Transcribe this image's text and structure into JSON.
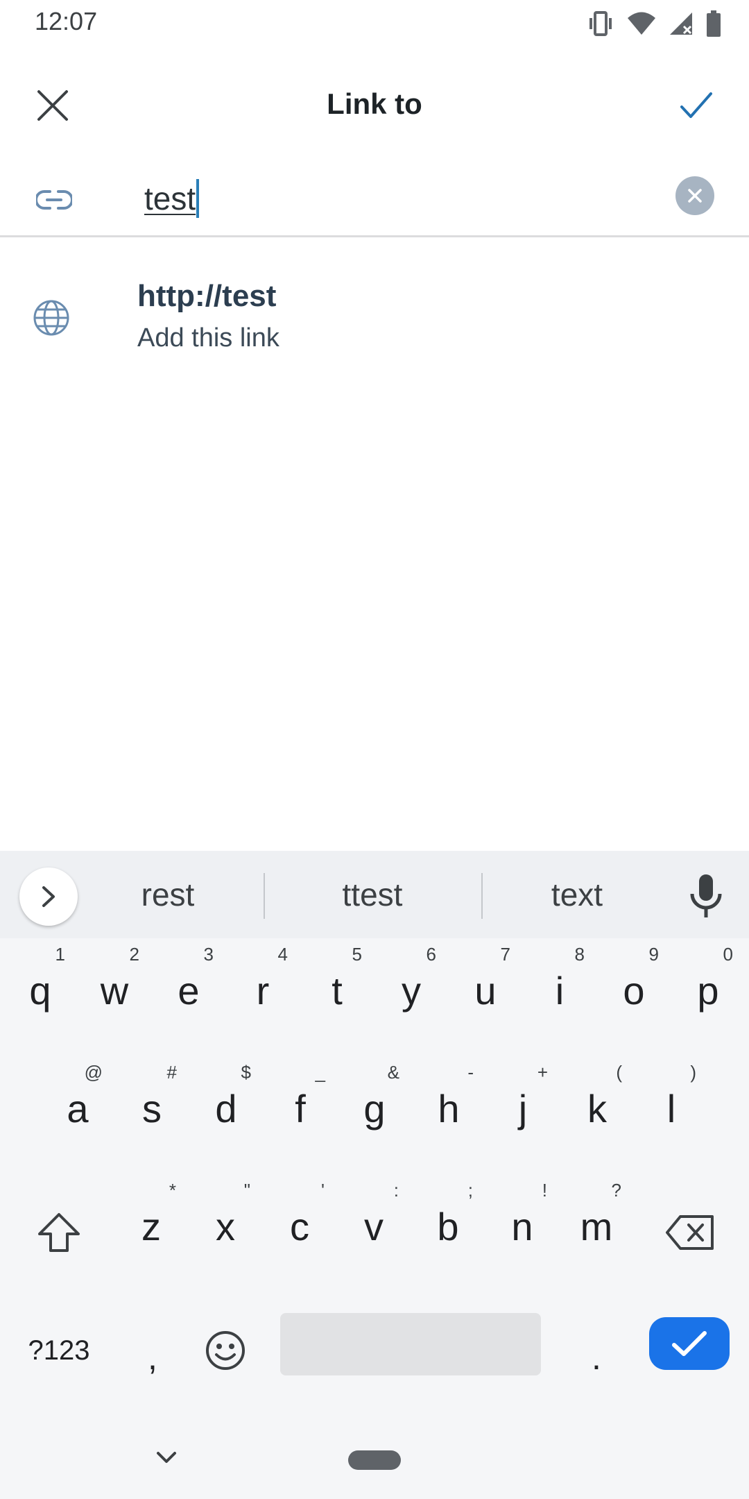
{
  "status_bar": {
    "time": "12:07",
    "icons": [
      "vibrate-icon",
      "wifi-icon",
      "signal-icon",
      "battery-icon"
    ]
  },
  "app_bar": {
    "title": "Link to",
    "close_icon": "close-icon",
    "confirm_icon": "check-icon",
    "accent_color": "#2271b1"
  },
  "url_field": {
    "value": "test",
    "link_icon": "link-icon",
    "clear_icon": "clear-icon"
  },
  "suggestion": {
    "url": "http://test",
    "action": "Add this link",
    "icon": "globe-icon"
  },
  "keyboard": {
    "suggestions": [
      "rest",
      "ttest",
      "text"
    ],
    "row1": [
      {
        "ch": "q",
        "hint": "1"
      },
      {
        "ch": "w",
        "hint": "2"
      },
      {
        "ch": "e",
        "hint": "3"
      },
      {
        "ch": "r",
        "hint": "4"
      },
      {
        "ch": "t",
        "hint": "5"
      },
      {
        "ch": "y",
        "hint": "6"
      },
      {
        "ch": "u",
        "hint": "7"
      },
      {
        "ch": "i",
        "hint": "8"
      },
      {
        "ch": "o",
        "hint": "9"
      },
      {
        "ch": "p",
        "hint": "0"
      }
    ],
    "row2": [
      {
        "ch": "a",
        "hint": "@"
      },
      {
        "ch": "s",
        "hint": "#"
      },
      {
        "ch": "d",
        "hint": "$"
      },
      {
        "ch": "f",
        "hint": "_"
      },
      {
        "ch": "g",
        "hint": "&"
      },
      {
        "ch": "h",
        "hint": "-"
      },
      {
        "ch": "j",
        "hint": "+"
      },
      {
        "ch": "k",
        "hint": "("
      },
      {
        "ch": "l",
        "hint": ")"
      }
    ],
    "row3": [
      {
        "ch": "z",
        "hint": "*"
      },
      {
        "ch": "x",
        "hint": "\""
      },
      {
        "ch": "c",
        "hint": "'"
      },
      {
        "ch": "v",
        "hint": ":"
      },
      {
        "ch": "b",
        "hint": ";"
      },
      {
        "ch": "n",
        "hint": "!"
      },
      {
        "ch": "m",
        "hint": "?"
      }
    ],
    "symbols_label": "?123",
    "comma": ",",
    "period": ".",
    "enter_color": "#1a73e8"
  }
}
